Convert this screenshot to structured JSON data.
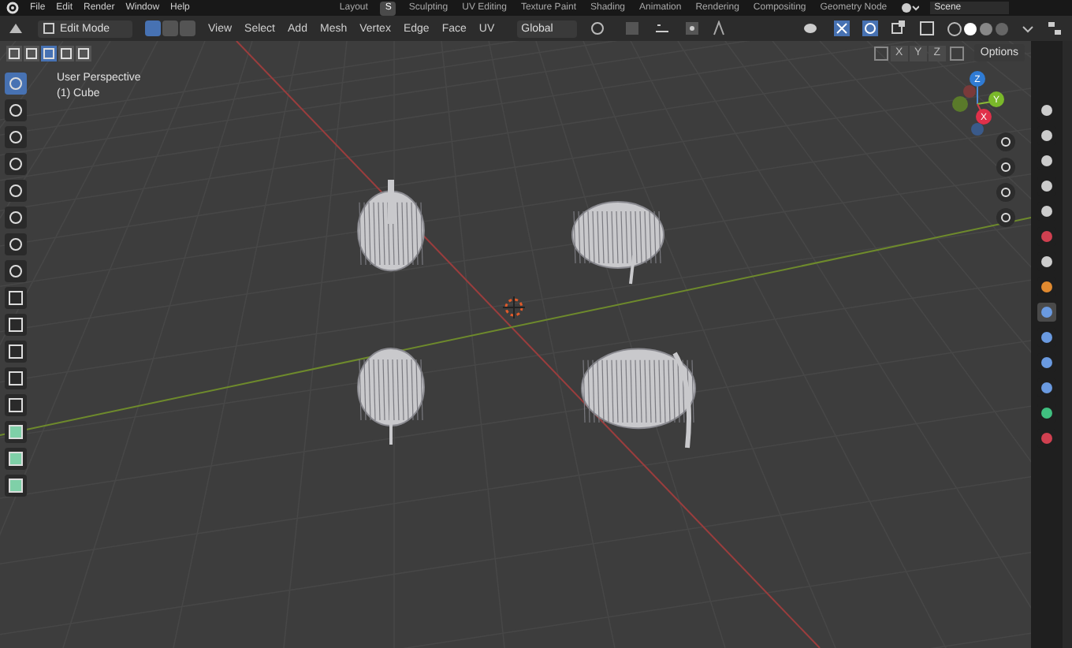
{
  "top_menu": [
    "File",
    "Edit",
    "Render",
    "Window",
    "Help"
  ],
  "workspace_tabs": [
    {
      "label": "Layout",
      "selected": false
    },
    {
      "label": "S",
      "selected": true
    },
    {
      "label": "Sculpting",
      "selected": false
    },
    {
      "label": "UV Editing",
      "selected": false
    },
    {
      "label": "Texture Paint",
      "selected": false
    },
    {
      "label": "Shading",
      "selected": false
    },
    {
      "label": "Animation",
      "selected": false
    },
    {
      "label": "Rendering",
      "selected": false
    },
    {
      "label": "Compositing",
      "selected": false
    },
    {
      "label": "Geometry Node",
      "selected": false
    }
  ],
  "scene": "Scene",
  "header": {
    "mode": "Edit Mode",
    "select_modes": [
      {
        "selected": true
      },
      {
        "selected": false
      },
      {
        "selected": false
      }
    ],
    "menus": [
      "View",
      "Select",
      "Add",
      "Mesh",
      "Vertex",
      "Edge",
      "Face",
      "UV"
    ],
    "orientation": "Global"
  },
  "sub_header": {
    "axes": [
      "X",
      "Y",
      "Z"
    ],
    "options": "Options"
  },
  "viewport": {
    "view_name": "User Perspective",
    "object_name": "(1) Cube",
    "gizmo_axes": [
      "Z",
      "Y",
      "X"
    ]
  },
  "tools": [
    {
      "selected": true
    },
    {
      "selected": false
    },
    {
      "selected": false
    },
    {
      "selected": false
    },
    {
      "selected": false
    },
    {
      "selected": false
    },
    {
      "selected": false
    },
    {
      "selected": false
    },
    {
      "selected": false
    },
    {
      "selected": false
    },
    {
      "selected": false
    },
    {
      "selected": false
    },
    {
      "selected": false
    },
    {
      "selected": false
    },
    {
      "selected": false
    },
    {
      "selected": false
    }
  ],
  "property_tabs": [
    {
      "selected": false
    },
    {
      "selected": false
    },
    {
      "selected": false
    },
    {
      "selected": false
    },
    {
      "selected": false
    },
    {
      "selected": false
    },
    {
      "selected": false
    },
    {
      "selected": false
    },
    {
      "selected": true
    },
    {
      "selected": false
    },
    {
      "selected": false
    },
    {
      "selected": false
    },
    {
      "selected": false
    },
    {
      "selected": false
    }
  ]
}
